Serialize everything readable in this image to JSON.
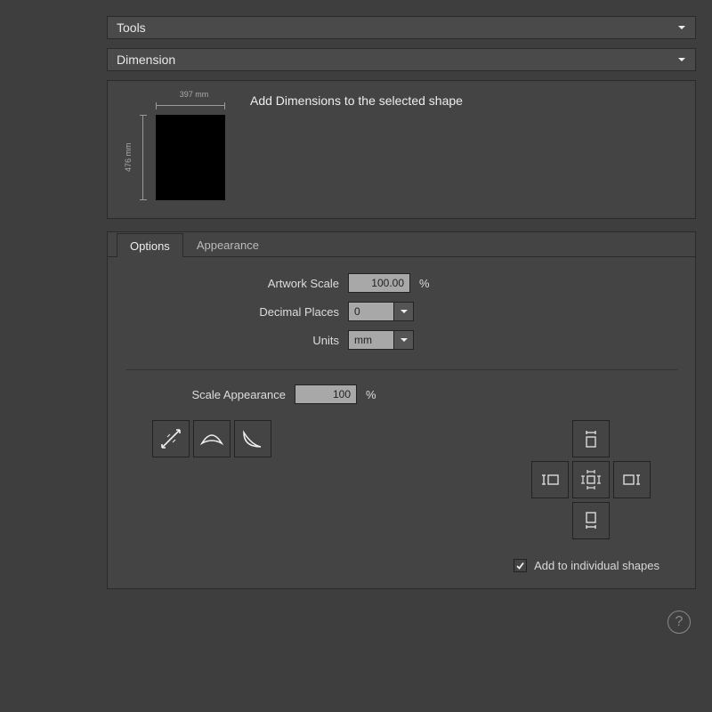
{
  "accordion": {
    "tools": "Tools",
    "dimension": "Dimension"
  },
  "description": {
    "text": "Add Dimensions to the selected shape",
    "thumb": {
      "width_label": "397 mm",
      "height_label": "476 mm"
    }
  },
  "tabs": {
    "options": "Options",
    "appearance": "Appearance"
  },
  "options": {
    "artwork_scale_label": "Artwork Scale",
    "artwork_scale_value": "100.00",
    "percent": "%",
    "decimal_places_label": "Decimal Places",
    "decimal_places_value": "0",
    "units_label": "Units",
    "units_value": "mm",
    "scale_appearance_label": "Scale Appearance",
    "scale_appearance_value": "100"
  },
  "tool_buttons": {
    "linear": "dimension-linear-icon",
    "arc": "dimension-arc-icon",
    "chord": "dimension-chord-icon"
  },
  "placement": {
    "top": "place-top",
    "left": "place-left",
    "all": "place-all",
    "right": "place-right",
    "bottom": "place-bottom"
  },
  "checkbox": {
    "add_individual_label": "Add to individual shapes",
    "add_individual_checked": true
  },
  "help": "?"
}
